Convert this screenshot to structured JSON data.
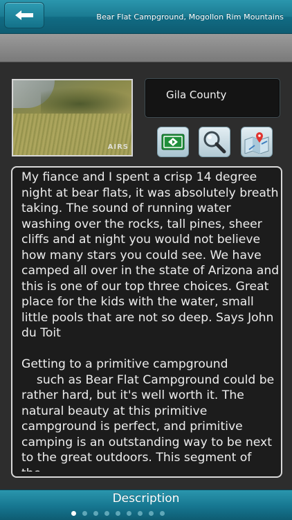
{
  "nav": {
    "title": "Bear Flat Campground, Mogollon Rim Mountains",
    "back_icon": "back-arrow-icon"
  },
  "photo": {
    "watermark": "AIRS"
  },
  "location": {
    "county": "Gila County"
  },
  "actions": [
    {
      "name": "directions",
      "icon": "directions-sign-icon"
    },
    {
      "name": "search",
      "icon": "magnifier-icon"
    },
    {
      "name": "map",
      "icon": "map-pin-icon"
    }
  ],
  "description": {
    "text": "My fiance and I spent a crisp 14 degree night at bear flats, it was absolutely breath taking. The sound of running water washing over the rocks, tall pines, sheer cliffs and at night you would not believe how many stars you could see. We have camped all over in the state of Arizona and this is one of our top three choices. Great place for the kids with the water, small little pools that are not so deep. Says John du Toit\n\nGetting to a primitive campground\n    such as Bear Flat Campground could be rather hard, but it's well worth it. The natural beauty at this primitive campground is perfect, and primitive camping is an outstanding way to be next to the great outdoors. This segment of the..."
  },
  "footer": {
    "title": "Description",
    "page_count": 9,
    "active_page": 1
  },
  "colors": {
    "accent": "#1a7a91",
    "panel_bg": "#1c1c1c",
    "body_bg": "#2d2d2d"
  }
}
